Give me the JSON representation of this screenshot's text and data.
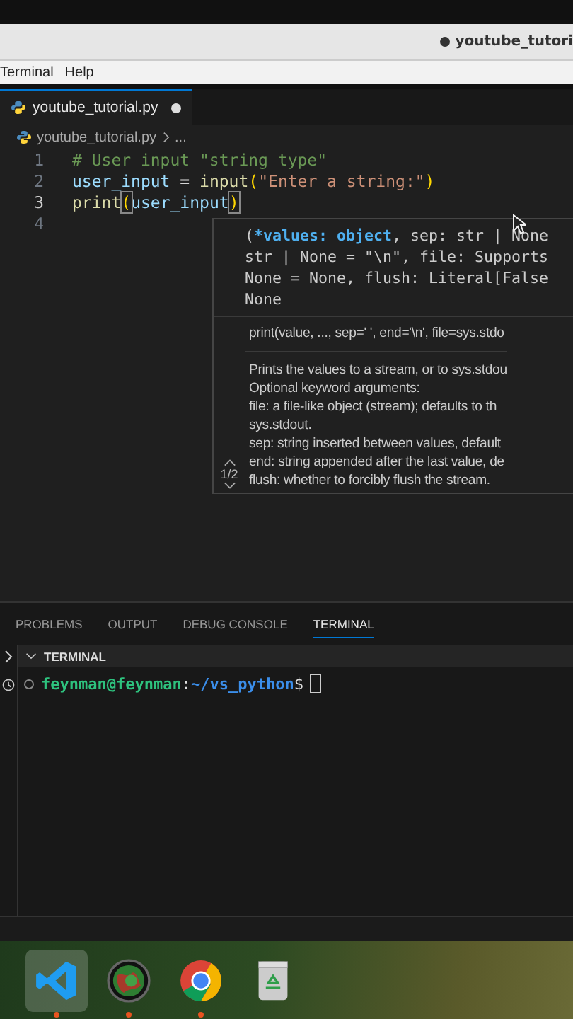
{
  "window": {
    "title": "youtube_tutori",
    "modified": true
  },
  "menu": [
    "Terminal",
    "Help"
  ],
  "editor_tabs": [
    {
      "label": "youtube_tutorial.py",
      "selected": true,
      "modified": true
    }
  ],
  "breadcrumb": [
    "youtube_tutorial.py",
    "..."
  ],
  "code": [
    {
      "number": "1",
      "current": false,
      "tokens": [
        {
          "kind": "comment",
          "text": "# User input \"string type\""
        }
      ]
    },
    {
      "number": "2",
      "current": false,
      "tokens": [
        {
          "kind": "var",
          "text": "user_input"
        },
        {
          "kind": "plain",
          "text": " = "
        },
        {
          "kind": "func",
          "text": "input"
        },
        {
          "kind": "paren",
          "text": "("
        },
        {
          "kind": "string",
          "text": "\"Enter a string:\""
        },
        {
          "kind": "paren",
          "text": ")"
        }
      ]
    },
    {
      "number": "3",
      "current": true,
      "tokens": [
        {
          "kind": "func",
          "text": "print"
        },
        {
          "kind": "match",
          "text": "("
        },
        {
          "kind": "var",
          "text": "user_input"
        },
        {
          "kind": "match",
          "text": ")"
        }
      ]
    },
    {
      "number": "4",
      "current": false
    }
  ],
  "hover": {
    "signature": [
      [
        {
          "kind": "plain",
          "text": "("
        },
        {
          "kind": "active",
          "text": "*values: object"
        },
        {
          "kind": "plain",
          "text": ", sep: str | None"
        }
      ],
      [
        {
          "kind": "plain",
          "text": "str | None = \"\\n\", file: Supports"
        }
      ],
      [
        {
          "kind": "plain",
          "text": "None = None, flush: Literal[False"
        }
      ],
      [
        {
          "kind": "plain",
          "text": "None"
        }
      ]
    ],
    "usage": "print(value, ..., sep=' ', end='\\n', file=sys.stdo",
    "doc": [
      "Prints the values to a stream, or to sys.stdou",
      "Optional keyword arguments:",
      "file: a file-like object (stream); defaults to th",
      "sys.stdout.",
      "sep: string inserted between values, default",
      "end: string appended after the last value, de",
      "flush: whether to forcibly flush the stream."
    ],
    "pager": "1/2"
  },
  "panel_tabs": [
    {
      "label": "PROBLEMS",
      "selected": false
    },
    {
      "label": "OUTPUT",
      "selected": false
    },
    {
      "label": "DEBUG CONSOLE",
      "selected": false
    },
    {
      "label": "TERMINAL",
      "selected": true
    }
  ],
  "terminal": {
    "section": "TERMINAL",
    "expanded": true,
    "user": "feynman@feynman",
    "separator": ":",
    "path": "~/vs_python",
    "prompt": "$"
  },
  "dock": [
    {
      "kind": "editor",
      "active": true,
      "running": true
    },
    {
      "kind": "globe",
      "active": false,
      "running": true
    },
    {
      "kind": "browser",
      "active": false,
      "running": true
    },
    {
      "kind": "trash",
      "active": false,
      "running": false
    }
  ]
}
